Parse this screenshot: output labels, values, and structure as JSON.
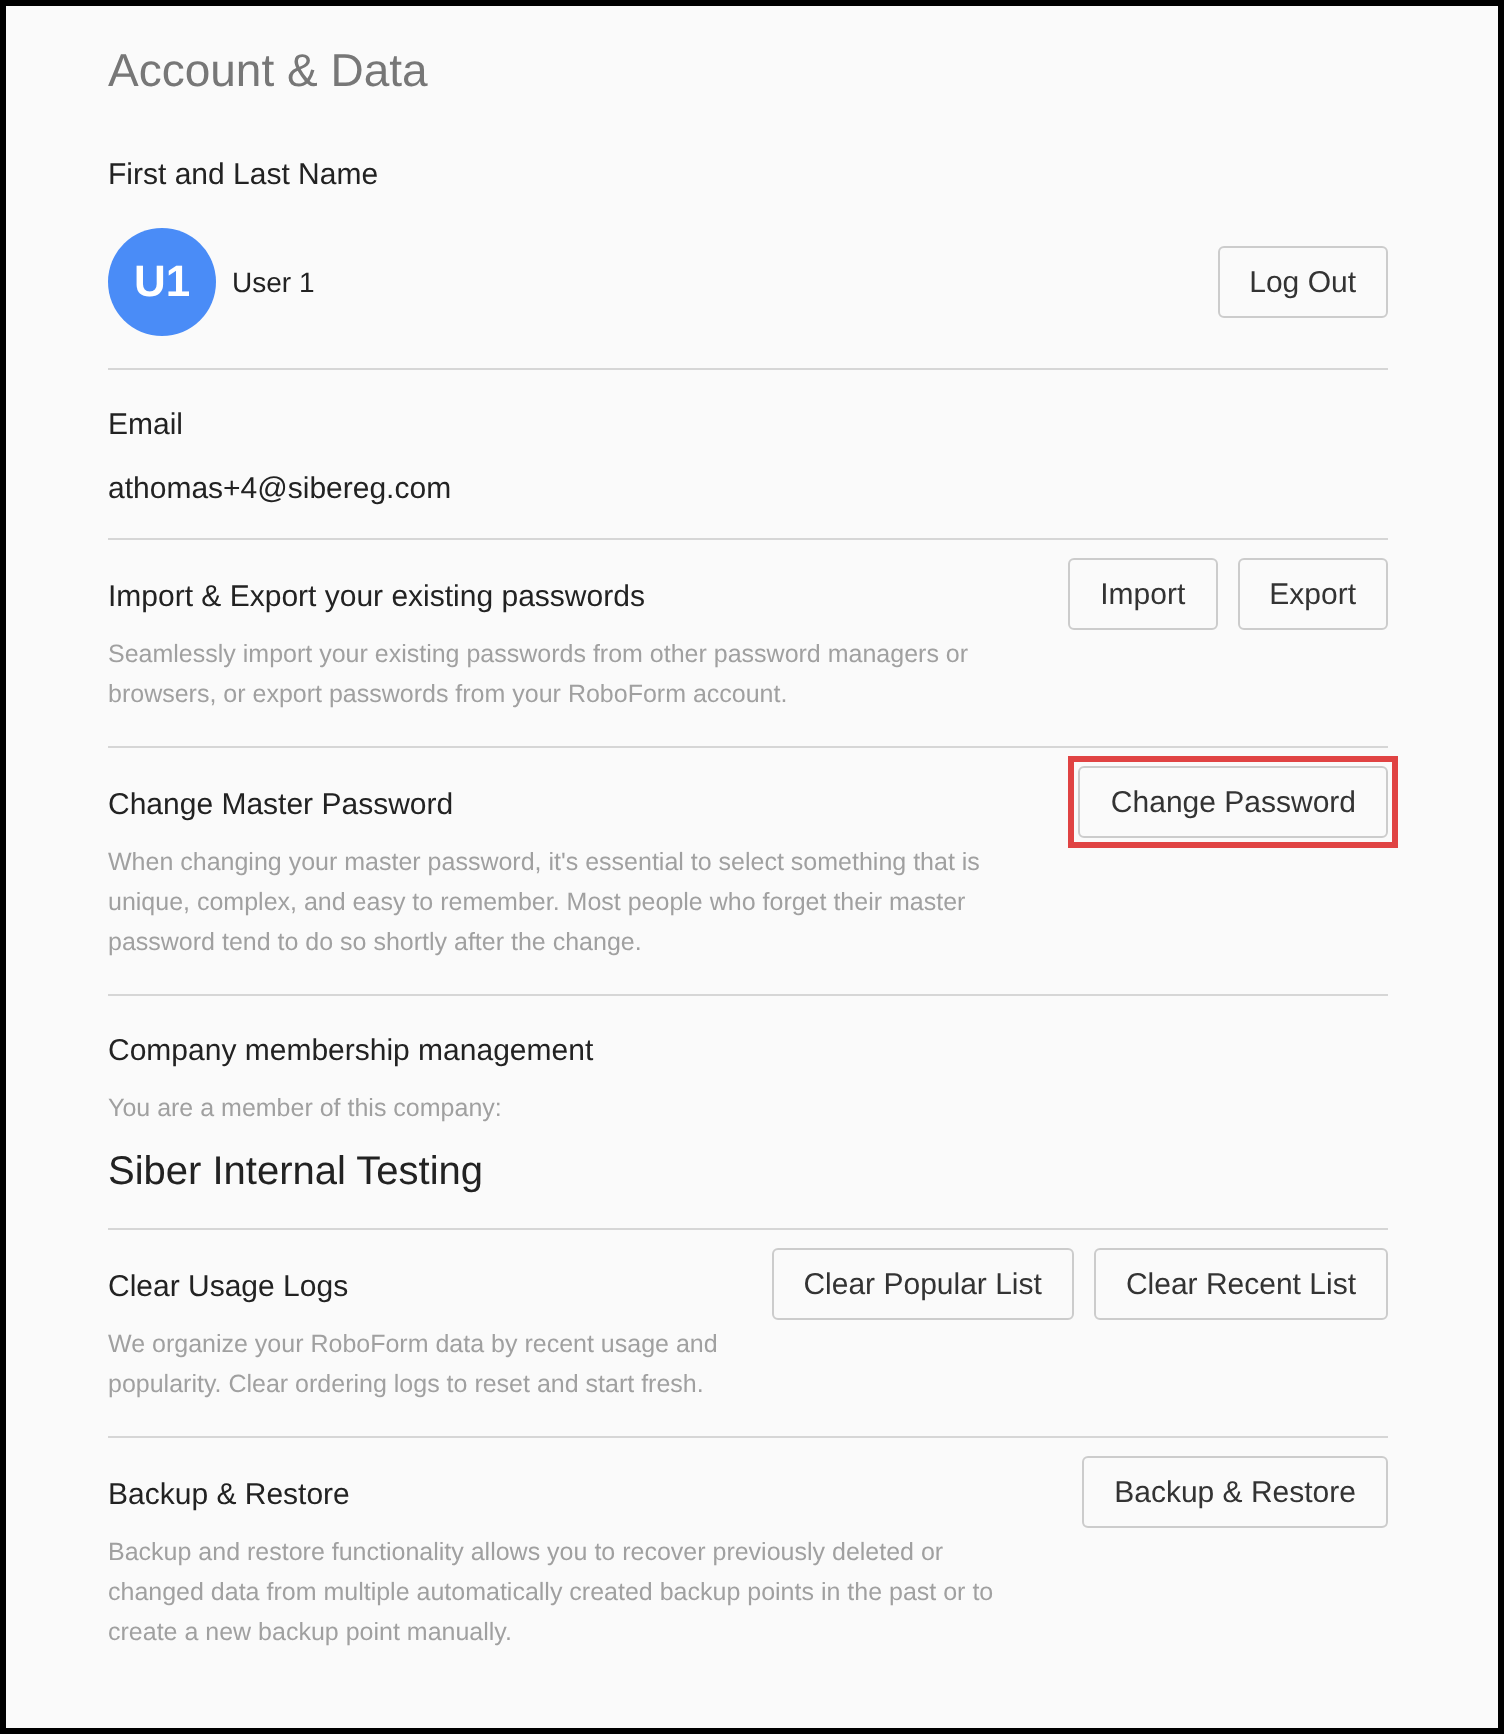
{
  "title": "Account & Data",
  "sections": [
    {
      "kind": "profile",
      "label": "First and Last Name",
      "avatar": "U1",
      "name": "User 1",
      "buttons": [
        {
          "label": "Log Out",
          "highlighted": false
        }
      ]
    },
    {
      "kind": "email",
      "label": "Email",
      "value": "athomas+4@sibereg.com"
    },
    {
      "kind": "action",
      "label": "Import & Export your existing passwords",
      "description": "Seamlessly import your existing passwords from other password managers or browsers, or export passwords from your RoboForm account.",
      "buttons": [
        {
          "label": "Import",
          "highlighted": false
        },
        {
          "label": "Export",
          "highlighted": false
        }
      ]
    },
    {
      "kind": "action",
      "label": "Change Master Password",
      "description": "When changing your master password, it's essential to select something that is unique, complex, and easy to remember. Most people who forget their master password tend to do so shortly after the change.",
      "buttons": [
        {
          "label": "Change Password",
          "highlighted": true
        }
      ]
    },
    {
      "kind": "company",
      "label": "Company membership management",
      "description": "You are a member of this company:",
      "value": "Siber Internal Testing"
    },
    {
      "kind": "action",
      "label": "Clear Usage Logs",
      "description": "We organize your RoboForm data by recent usage and popularity. Clear ordering logs to reset and start fresh.",
      "buttons": [
        {
          "label": "Clear Popular List",
          "highlighted": false
        },
        {
          "label": "Clear Recent List",
          "highlighted": false
        }
      ]
    },
    {
      "kind": "action",
      "label": "Backup & Restore",
      "description": "Backup and restore functionality allows you to recover previously deleted or changed data from multiple automatically created backup points in the past or to create a new backup point manually.",
      "buttons": [
        {
          "label": "Backup & Restore",
          "highlighted": false
        }
      ]
    }
  ]
}
